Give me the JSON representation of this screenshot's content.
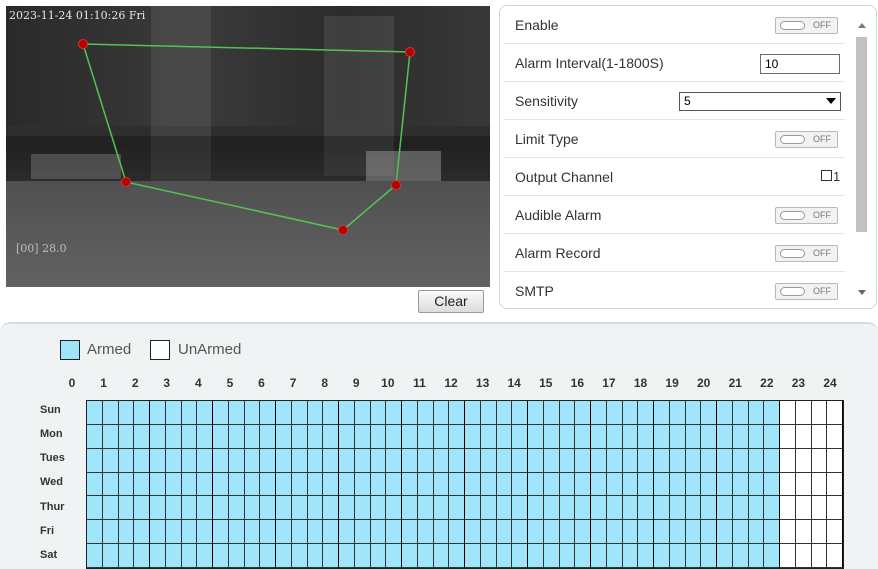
{
  "video": {
    "timestamp": "2023-11-24 01:10:26 Fri",
    "overlay_text": "[00] 28.0"
  },
  "colors": {
    "armed": "#a0e6fb",
    "unarmed": "#ffffff",
    "polygon_line": "#54c257",
    "polygon_point": "#b00000"
  },
  "buttons": {
    "clear": "Clear"
  },
  "settings": {
    "enable": {
      "label": "Enable",
      "state": "OFF"
    },
    "alarm_interval": {
      "label": "Alarm Interval(1-1800S)",
      "value": "10"
    },
    "sensitivity": {
      "label": "Sensitivity",
      "value": "5"
    },
    "limit_type": {
      "label": "Limit Type",
      "state": "OFF"
    },
    "output_channel": {
      "label": "Output Channel",
      "option": "1"
    },
    "audible_alarm": {
      "label": "Audible Alarm",
      "state": "OFF"
    },
    "alarm_record": {
      "label": "Alarm Record",
      "state": "OFF"
    },
    "smtp": {
      "label": "SMTP",
      "state": "OFF"
    }
  },
  "schedule": {
    "legend": {
      "armed": "Armed",
      "unarmed": "UnArmed"
    },
    "hours": [
      "0",
      "1",
      "2",
      "3",
      "4",
      "5",
      "6",
      "7",
      "8",
      "9",
      "10",
      "11",
      "12",
      "13",
      "14",
      "15",
      "16",
      "17",
      "18",
      "19",
      "20",
      "21",
      "22",
      "23",
      "24"
    ],
    "days": [
      "Sun",
      "Mon",
      "Tues",
      "Wed",
      "Thur",
      "Fri",
      "Sat"
    ],
    "armed_hours": [
      0,
      22
    ]
  }
}
